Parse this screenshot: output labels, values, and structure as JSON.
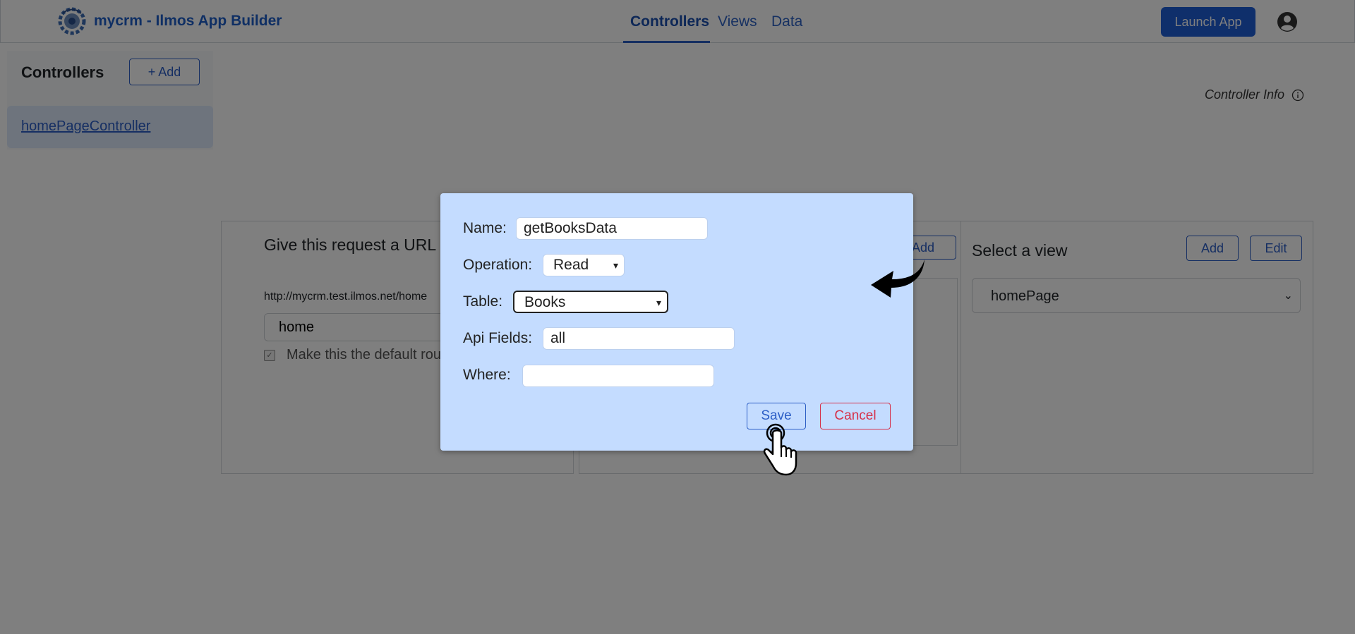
{
  "app": {
    "title": "mycrm - Ilmos App Builder"
  },
  "nav": {
    "tabs": [
      "Controllers",
      "Views",
      "Data"
    ],
    "launch_label": "Launch App"
  },
  "sidebar": {
    "title": "Controllers",
    "add_label": "+ Add",
    "items": [
      {
        "label": "homePageController"
      }
    ]
  },
  "info": {
    "label": "Controller Info"
  },
  "url_card": {
    "title": "Give this request a URL",
    "prefix": "http://mycrm.test.ilmos.net/home",
    "value": "home",
    "default_label": "Make this the default route"
  },
  "middle_card": {
    "add_label": "Add"
  },
  "view_card": {
    "title": "Select a view",
    "add_label": "Add",
    "edit_label": "Edit",
    "selected": "homePage"
  },
  "modal": {
    "name_label": "Name:",
    "name_value": "getBooksData",
    "operation_label": "Operation:",
    "operation_value": "Read",
    "table_label": "Table:",
    "table_value": "Books",
    "api_label": "Api Fields:",
    "api_value": "all",
    "where_label": "Where:",
    "where_value": "",
    "save_label": "Save",
    "cancel_label": "Cancel"
  },
  "colors": {
    "primary": "#1f5fd6",
    "modal_bg": "#c4dcff",
    "danger": "#d6314a"
  }
}
